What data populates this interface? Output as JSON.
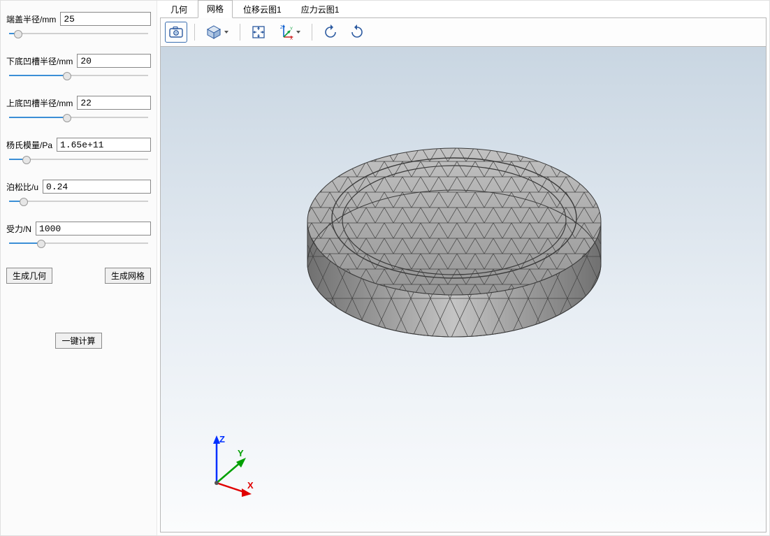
{
  "params": [
    {
      "label": "端盖半径/mm",
      "value": "25",
      "slider_pct": 8
    },
    {
      "label": "下底凹槽半径/mm",
      "value": "20",
      "slider_pct": 42
    },
    {
      "label": "上底凹槽半径/mm",
      "value": "22",
      "slider_pct": 42
    },
    {
      "label": "杨氏模量/Pa",
      "value": "1.65e+11",
      "slider_pct": 14
    },
    {
      "label": "泊松比/u",
      "value": "0.24",
      "slider_pct": 12
    },
    {
      "label": "受力/N",
      "value": "1000",
      "slider_pct": 24
    }
  ],
  "buttons": {
    "gen_geometry": "生成几何",
    "gen_mesh": "生成网格",
    "one_click_calc": "一键计算"
  },
  "tabs": [
    "几何",
    "网格",
    "位移云图1",
    "应力云图1"
  ],
  "active_tab_index": 1,
  "toolbar": {
    "camera": "camera-icon",
    "cube": "isometric-view-icon",
    "fit": "fit-view-icon",
    "axes": "axes-icon",
    "rotate_ccw": "rotate-ccw-icon",
    "rotate_cw": "rotate-cw-icon"
  },
  "triad_labels": {
    "x": "X",
    "y": "Y",
    "z": "Z"
  }
}
